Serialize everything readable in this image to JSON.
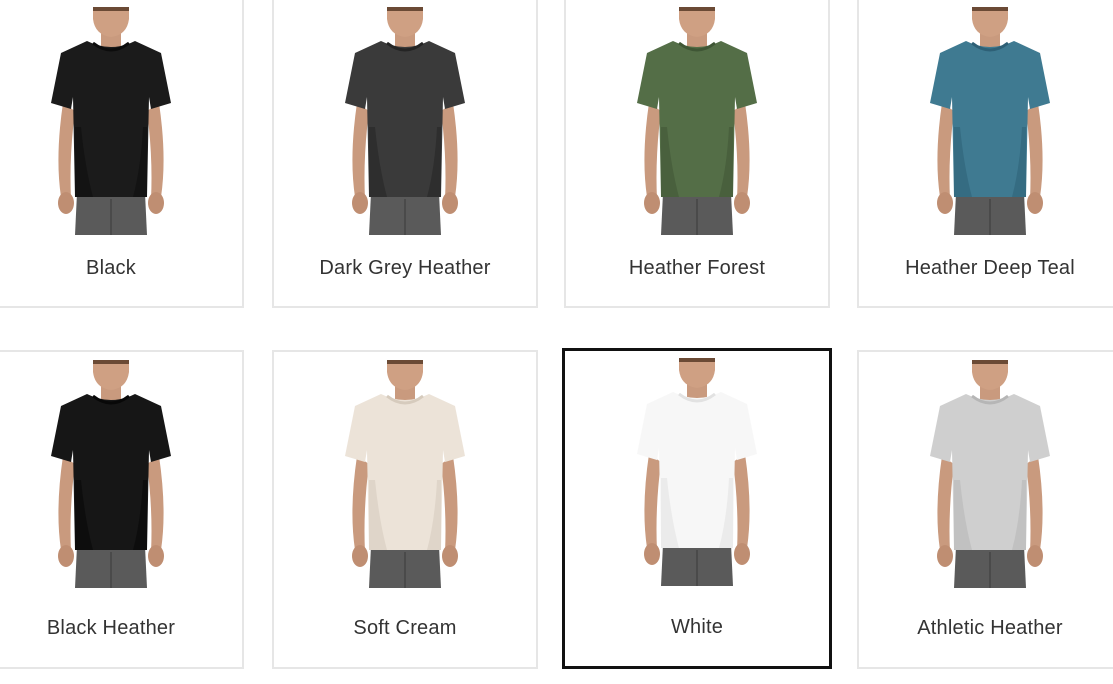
{
  "swatches": [
    {
      "label": "Black",
      "shirt_color": "#1b1b1b",
      "shirt_shade": "#0c0c0c",
      "selected": false
    },
    {
      "label": "Dark Grey Heather",
      "shirt_color": "#3a3a3a",
      "shirt_shade": "#242424",
      "selected": false
    },
    {
      "label": "Heather Forest",
      "shirt_color": "#546e47",
      "shirt_shade": "#3f5635",
      "selected": false
    },
    {
      "label": "Heather Deep Teal",
      "shirt_color": "#3f7a91",
      "shirt_shade": "#2e6076",
      "selected": false
    },
    {
      "label": "Black Heather",
      "shirt_color": "#161616",
      "shirt_shade": "#080808",
      "selected": false
    },
    {
      "label": "Soft Cream",
      "shirt_color": "#ece3d8",
      "shirt_shade": "#d6cbbd",
      "selected": false
    },
    {
      "label": "White",
      "shirt_color": "#f7f7f7",
      "shirt_shade": "#e2e2e2",
      "selected": true
    },
    {
      "label": "Athletic Heather",
      "shirt_color": "#cfcfcf",
      "shirt_shade": "#b6b6b6",
      "selected": false
    }
  ]
}
